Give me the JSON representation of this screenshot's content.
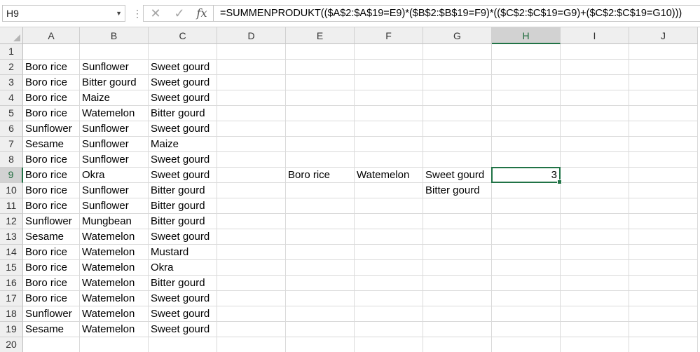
{
  "name_box": "H9",
  "formula_bar": {
    "cancel_glyph": "✕",
    "enter_glyph": "✓",
    "fx_label": "fx",
    "formula": "=SUMMENPRODUKT(($A$2:$A$19=E9)*($B$2:$B$19=F9)*(($C$2:$C$19=G9)+($C$2:$C$19=G10)))"
  },
  "columns": [
    "A",
    "B",
    "C",
    "D",
    "E",
    "F",
    "G",
    "H",
    "I",
    "J"
  ],
  "selected": {
    "column": "H",
    "row": 9
  },
  "rows": [
    {
      "row": 1,
      "cells": {}
    },
    {
      "row": 2,
      "cells": {
        "A": "Boro rice",
        "B": "Sunflower",
        "C": "Sweet gourd"
      }
    },
    {
      "row": 3,
      "cells": {
        "A": "Boro rice",
        "B": "Bitter gourd",
        "C": "Sweet gourd"
      }
    },
    {
      "row": 4,
      "cells": {
        "A": "Boro rice",
        "B": "Maize",
        "C": "Sweet gourd"
      }
    },
    {
      "row": 5,
      "cells": {
        "A": "Boro rice",
        "B": "Watemelon",
        "C": "Bitter gourd"
      }
    },
    {
      "row": 6,
      "cells": {
        "A": "Sunflower",
        "B": "Sunflower",
        "C": "Sweet gourd"
      }
    },
    {
      "row": 7,
      "cells": {
        "A": "Sesame",
        "B": "Sunflower",
        "C": "Maize"
      }
    },
    {
      "row": 8,
      "cells": {
        "A": "Boro rice",
        "B": "Sunflower",
        "C": "Sweet gourd"
      }
    },
    {
      "row": 9,
      "cells": {
        "A": "Boro rice",
        "B": "Okra",
        "C": "Sweet gourd",
        "E": "Boro rice",
        "F": "Watemelon",
        "G": "Sweet gourd",
        "H": "3"
      }
    },
    {
      "row": 10,
      "cells": {
        "A": "Boro rice",
        "B": "Sunflower",
        "C": "Bitter gourd",
        "G": "Bitter gourd"
      }
    },
    {
      "row": 11,
      "cells": {
        "A": "Boro rice",
        "B": "Sunflower",
        "C": "Bitter gourd"
      }
    },
    {
      "row": 12,
      "cells": {
        "A": "Sunflower",
        "B": "Mungbean",
        "C": "Bitter gourd"
      }
    },
    {
      "row": 13,
      "cells": {
        "A": "Sesame",
        "B": "Watemelon",
        "C": "Sweet gourd"
      }
    },
    {
      "row": 14,
      "cells": {
        "A": "Boro rice",
        "B": "Watemelon",
        "C": "Mustard"
      }
    },
    {
      "row": 15,
      "cells": {
        "A": "Boro rice",
        "B": "Watemelon",
        "C": "Okra"
      }
    },
    {
      "row": 16,
      "cells": {
        "A": "Boro rice",
        "B": "Watemelon",
        "C": "Bitter gourd"
      }
    },
    {
      "row": 17,
      "cells": {
        "A": "Boro rice",
        "B": "Watemelon",
        "C": "Sweet gourd"
      }
    },
    {
      "row": 18,
      "cells": {
        "A": "Sunflower",
        "B": "Watemelon",
        "C": "Sweet gourd"
      }
    },
    {
      "row": 19,
      "cells": {
        "A": "Sesame",
        "B": "Watemelon",
        "C": "Sweet gourd"
      }
    },
    {
      "row": 20,
      "cells": {}
    }
  ],
  "colors": {
    "accent": "#217346",
    "header_bg": "#efefef",
    "gridline": "#dadada"
  }
}
